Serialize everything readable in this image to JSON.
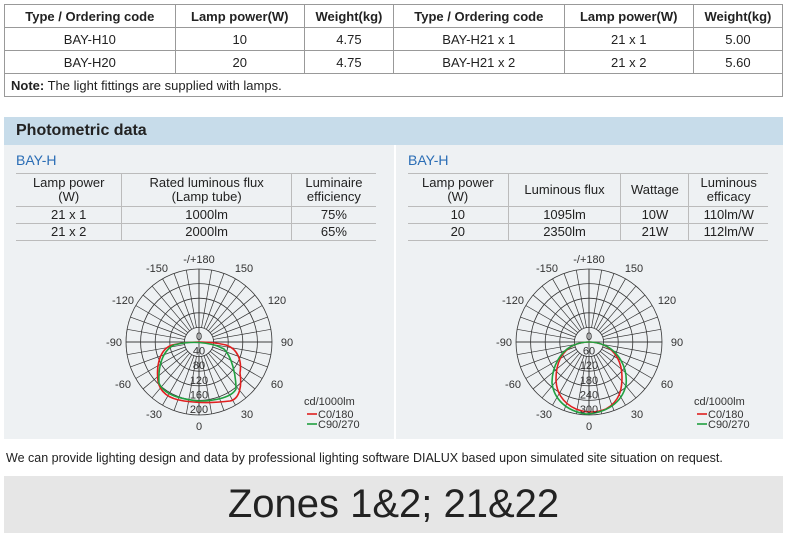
{
  "spec_table": {
    "headers": [
      "Type / Ordering code",
      "Lamp power(W)",
      "Weight(kg)",
      "Type / Ordering code",
      "Lamp power(W)",
      "Weight(kg)"
    ],
    "rows": [
      [
        "BAY-H10",
        "10",
        "4.75",
        "BAY-H21 x 1",
        "21 x 1",
        "5.00"
      ],
      [
        "BAY-H20",
        "20",
        "4.75",
        "BAY-H21 x 2",
        "21 x 2",
        "5.60"
      ]
    ],
    "note_label": "Note:",
    "note_text": " The light fittings are supplied with lamps."
  },
  "photometric": {
    "title": "Photometric data",
    "left": {
      "subtitle": "BAY-H",
      "headers": [
        "Lamp power\n(W)",
        "Rated luminous flux\n(Lamp tube)",
        "Luminaire\nefficiency"
      ],
      "rows": [
        [
          "21 x 1",
          "1000lm",
          "75%"
        ],
        [
          "21 x 2",
          "2000lm",
          "65%"
        ]
      ],
      "polar": {
        "angles": [
          "-/+180",
          "-150",
          "150",
          "-120",
          "120",
          "-90",
          "90",
          "-60",
          "60",
          "-30",
          "30",
          "0"
        ],
        "radial_labels": [
          "0",
          "40",
          "80",
          "120",
          "160",
          "200"
        ],
        "unit": "cd/1000lm",
        "legend": [
          "C0/180",
          "C90/270"
        ]
      }
    },
    "right": {
      "subtitle": "BAY-H",
      "headers": [
        "Lamp power\n(W)",
        "Luminous flux",
        "Wattage",
        "Luminous\nefficacy"
      ],
      "rows": [
        [
          "10",
          "1095lm",
          "10W",
          "110lm/W"
        ],
        [
          "20",
          "2350lm",
          "21W",
          "112lm/W"
        ]
      ],
      "polar": {
        "angles": [
          "-/+180",
          "-150",
          "150",
          "-120",
          "120",
          "-90",
          "90",
          "-60",
          "60",
          "-30",
          "30",
          "0"
        ],
        "radial_labels": [
          "0",
          "60",
          "120",
          "180",
          "240",
          "300"
        ],
        "unit": "cd/1000lm",
        "legend": [
          "C0/180",
          "C90/270"
        ]
      }
    },
    "colors": {
      "c0_180": "#e02020",
      "c90_270": "#20a040"
    }
  },
  "footer_text": "We can provide lighting design and data by professional lighting software DIALUX based upon simulated site situation on request.",
  "zones": "Zones 1&2; 21&22"
}
